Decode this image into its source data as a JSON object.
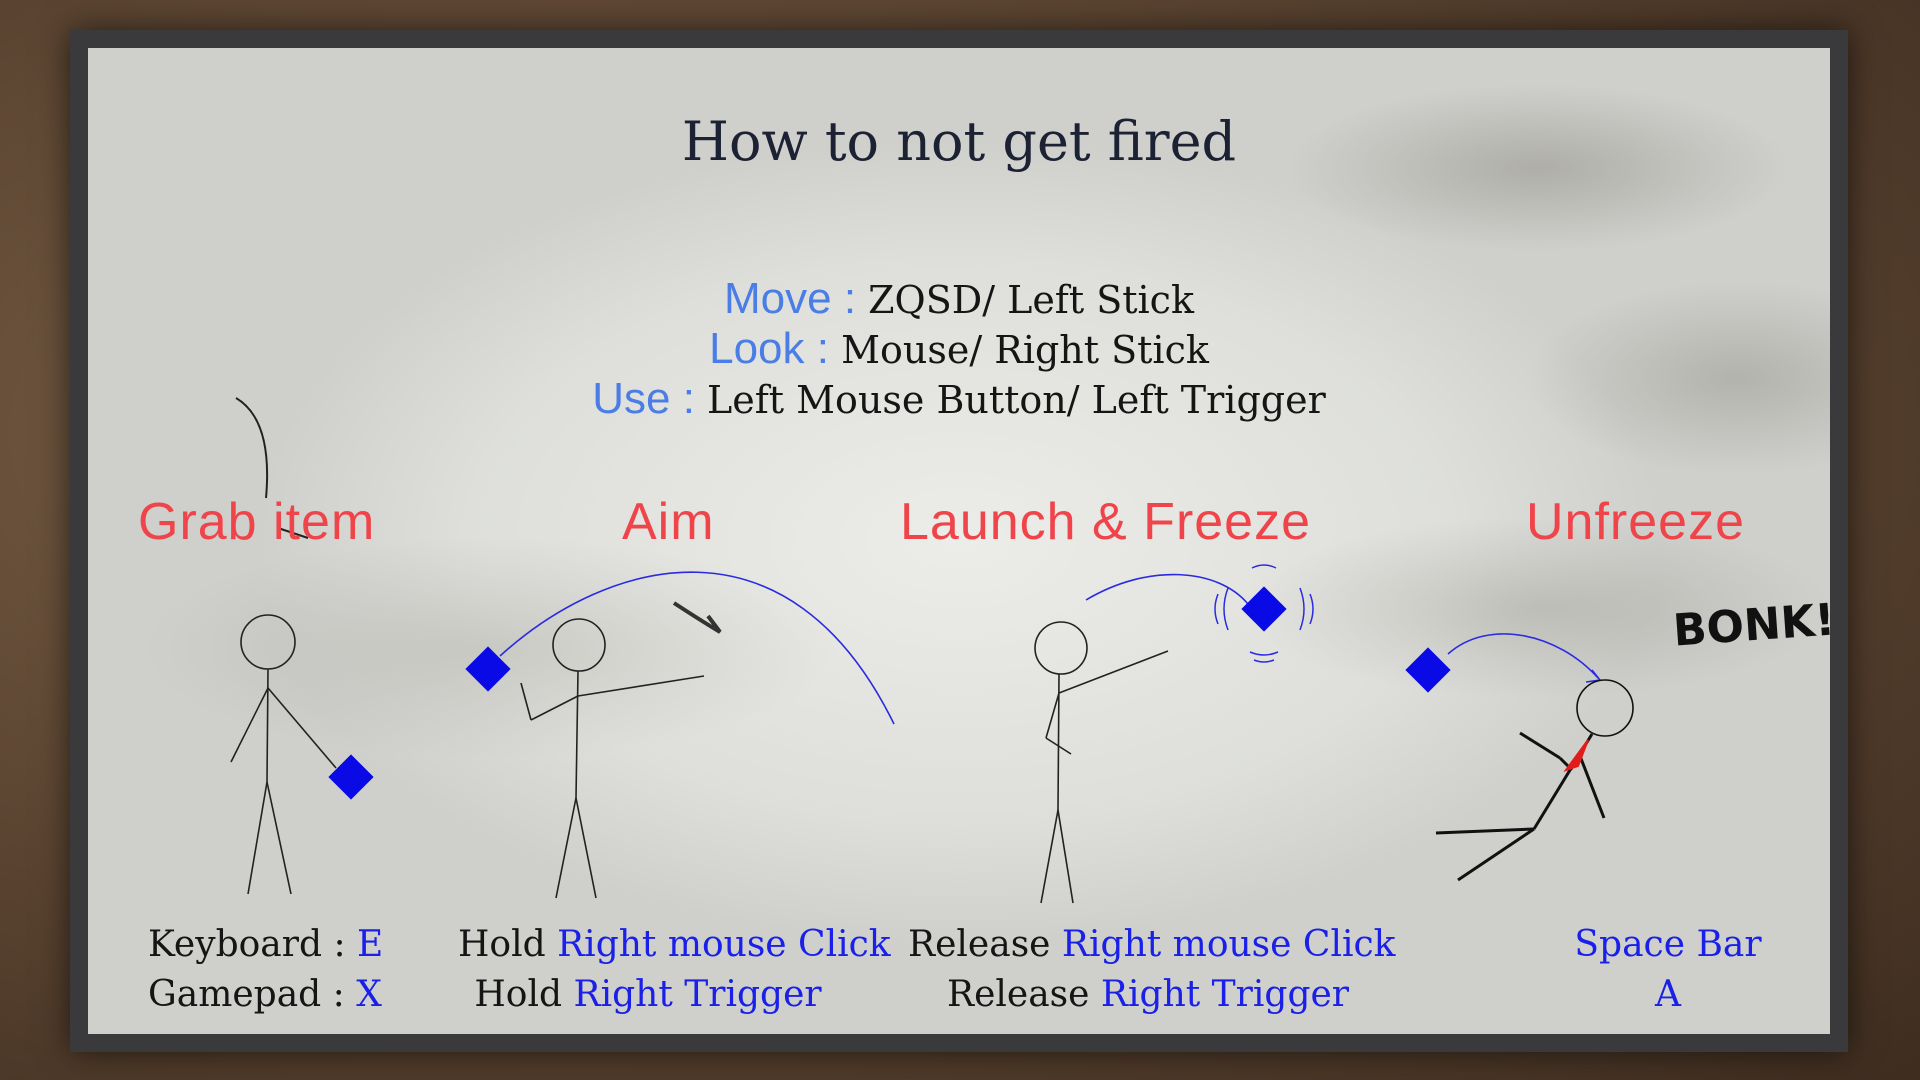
{
  "title": "How to not get fired",
  "controls": [
    {
      "key": "Move :",
      "value": "ZQSD/ Left Stick"
    },
    {
      "key": "Look :",
      "value": "Mouse/ Right Stick"
    },
    {
      "key": "Use :",
      "value": "Left Mouse Button/ Left Trigger"
    }
  ],
  "actions": [
    {
      "heading": "Grab item",
      "line1_prefix": "Keyboard : ",
      "line1_key": "E",
      "line2_prefix": "Gamepad : ",
      "line2_key": "X"
    },
    {
      "heading": "Aim",
      "line1_prefix": "Hold ",
      "line1_key": "Right mouse Click",
      "line2_prefix": "Hold ",
      "line2_key": "Right Trigger"
    },
    {
      "heading": "Launch & Freeze",
      "line1_prefix": "Release ",
      "line1_key": "Right mouse Click",
      "line2_prefix": "Release ",
      "line2_key": "Right Trigger"
    },
    {
      "heading": "Unfreeze",
      "line1_prefix": "",
      "line1_key": "Space Bar",
      "line2_prefix": "",
      "line2_key": "A"
    }
  ],
  "bonk_text": "BONK!",
  "colors": {
    "heading": "#f0444b",
    "control_key": "#4a7ee6",
    "binding": "#1a20e8",
    "item": "#0a0ae6",
    "text": "#151515"
  }
}
